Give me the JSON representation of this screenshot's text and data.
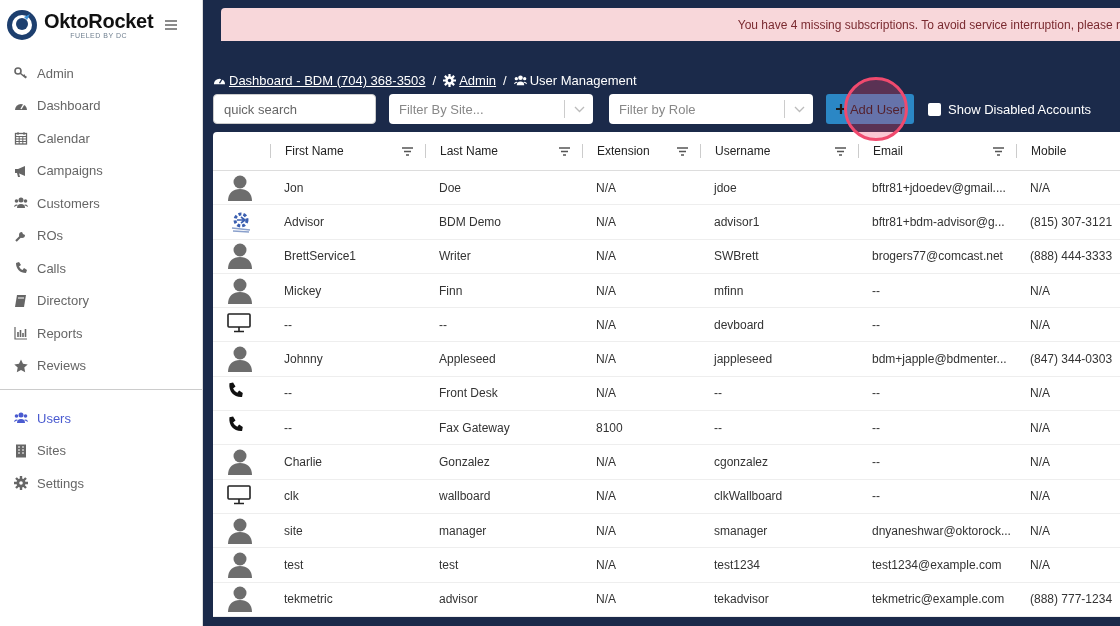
{
  "logo": {
    "name": "OktoRocket",
    "tagline": "FUELED BY DC"
  },
  "sidebar": {
    "items": [
      {
        "label": "Admin",
        "selected": false
      },
      {
        "label": "Dashboard",
        "selected": false
      },
      {
        "label": "Calendar",
        "selected": false
      },
      {
        "label": "Campaigns",
        "selected": false
      },
      {
        "label": "Customers",
        "selected": false
      },
      {
        "label": "ROs",
        "selected": false
      },
      {
        "label": "Calls",
        "selected": false
      },
      {
        "label": "Directory",
        "selected": false
      },
      {
        "label": "Reports",
        "selected": false
      },
      {
        "label": "Reviews",
        "selected": false
      }
    ],
    "bottom_items": [
      {
        "label": "Users",
        "selected": true
      },
      {
        "label": "Sites",
        "selected": false
      },
      {
        "label": "Settings",
        "selected": false
      }
    ]
  },
  "banner": "You have 4 missing subscriptions. To avoid service interruption, please r",
  "breadcrumb": [
    {
      "label": "Dashboard - BDM (704) 368-3503",
      "link": true
    },
    {
      "separator": "/",
      "label": "Admin",
      "link": true
    },
    {
      "separator": "/",
      "label": "User Management",
      "link": false
    }
  ],
  "controls": {
    "search": {
      "placeholder": "quick search"
    },
    "site_filter": {
      "placeholder": "Filter By Site..."
    },
    "role_filter": {
      "placeholder": "Filter by Role"
    },
    "add_button": "Add User",
    "show_disabled": {
      "label": "Show Disabled Accounts",
      "checked": false
    }
  },
  "table": {
    "columns": [
      "First Name",
      "Last Name",
      "Extension",
      "Username",
      "Email",
      "Mobile"
    ],
    "rows": [
      {
        "kind": "person",
        "cells": [
          "Jon",
          "Doe",
          "N/A",
          "jdoe",
          "bftr81+jdoedev@gmail....",
          "N/A"
        ]
      },
      {
        "kind": "logo",
        "cells": [
          "Advisor",
          "BDM Demo",
          "N/A",
          "advisor1",
          "bftr81+bdm-advisor@g...",
          "(815) 307-3121"
        ]
      },
      {
        "kind": "person",
        "cells": [
          "BrettService1",
          "Writer",
          "N/A",
          "SWBrett",
          "brogers77@comcast.net",
          "(888) 444-3333"
        ]
      },
      {
        "kind": "person",
        "cells": [
          "Mickey",
          "Finn",
          "N/A",
          "mfinn",
          "--",
          "N/A"
        ]
      },
      {
        "kind": "monitor",
        "cells": [
          "--",
          "--",
          "N/A",
          "devboard",
          "--",
          "N/A"
        ]
      },
      {
        "kind": "person",
        "cells": [
          "Johnny",
          "Appleseed",
          "N/A",
          "jappleseed",
          "bdm+japple@bdmenter...",
          "(847) 344-0303"
        ]
      },
      {
        "kind": "phone",
        "cells": [
          "--",
          "Front Desk",
          "N/A",
          "--",
          "--",
          "N/A"
        ]
      },
      {
        "kind": "phone",
        "cells": [
          "--",
          "Fax Gateway",
          "8100",
          "--",
          "--",
          "N/A"
        ]
      },
      {
        "kind": "person",
        "cells": [
          "Charlie",
          "Gonzalez",
          "N/A",
          "cgonzalez",
          "--",
          "N/A"
        ]
      },
      {
        "kind": "monitor",
        "cells": [
          "clk",
          "wallboard",
          "N/A",
          "clkWallboard",
          "--",
          "N/A"
        ]
      },
      {
        "kind": "person",
        "cells": [
          "site",
          "manager",
          "N/A",
          "smanager",
          "dnyaneshwar@oktorock...",
          "N/A"
        ]
      },
      {
        "kind": "person",
        "cells": [
          "test",
          "test",
          "N/A",
          "test1234",
          "test1234@example.com",
          "N/A"
        ]
      },
      {
        "kind": "person",
        "cells": [
          "tekmetric",
          "advisor",
          "N/A",
          "tekadvisor",
          "tekmetric@example.com",
          "(888) 777-1234"
        ]
      }
    ]
  },
  "click_highlight": true
}
